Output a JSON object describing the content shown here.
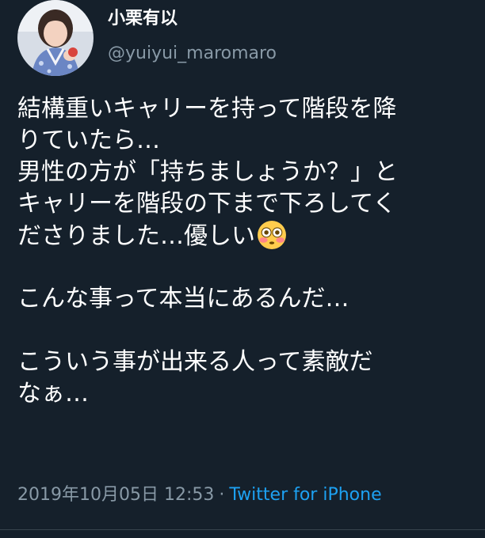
{
  "author": {
    "display_name": "小栗有以",
    "handle": "@yuiyui_maromaro"
  },
  "tweet": {
    "lines": [
      "結構重いキャリーを持って階段を降",
      "りていたら…",
      "男性の方が「持ちましょうか？」と",
      "キャリーを階段の下まで下ろしてく",
      "ださりました…優しい",
      "こんな事って本当にあるんだ…",
      "こういう事が出来る人って素敵だ",
      "なぁ…"
    ],
    "emoji": "flushed-face-icon"
  },
  "meta": {
    "timestamp": "2019年10月05日 12:53",
    "separator": "·",
    "source": "Twitter for iPhone"
  },
  "colors": {
    "background": "#15202b",
    "text": "#ffffff",
    "secondary": "#8899a6",
    "accent": "#1da1f2"
  }
}
